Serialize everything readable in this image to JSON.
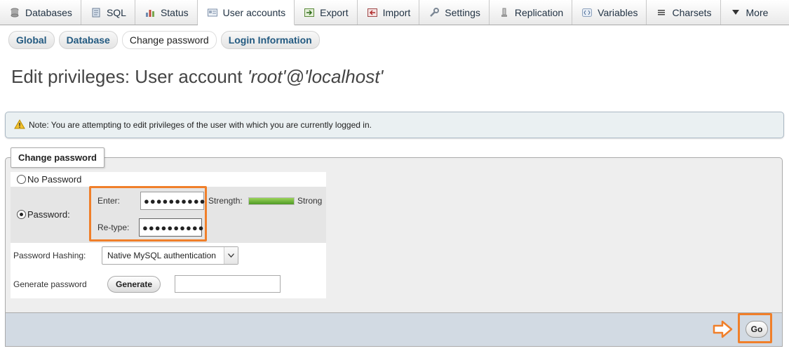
{
  "nav": {
    "tabs": [
      {
        "label": "Databases",
        "icon": "database-icon"
      },
      {
        "label": "SQL",
        "icon": "sql-icon"
      },
      {
        "label": "Status",
        "icon": "status-icon"
      },
      {
        "label": "User accounts",
        "icon": "user-accounts-icon",
        "active": true
      },
      {
        "label": "Export",
        "icon": "export-icon"
      },
      {
        "label": "Import",
        "icon": "import-icon"
      },
      {
        "label": "Settings",
        "icon": "wrench-icon"
      },
      {
        "label": "Replication",
        "icon": "replication-icon"
      },
      {
        "label": "Variables",
        "icon": "variables-icon"
      },
      {
        "label": "Charsets",
        "icon": "charsets-icon"
      },
      {
        "label": "More",
        "icon": "triangle-down-icon"
      }
    ]
  },
  "subnav": {
    "items": [
      {
        "label": "Global"
      },
      {
        "label": "Database"
      },
      {
        "label": "Change password",
        "active": true
      },
      {
        "label": "Login Information"
      }
    ]
  },
  "page": {
    "title_prefix": "Edit privileges: User account ",
    "title_user": "'root'@'localhost'"
  },
  "note": {
    "text": "Note: You are attempting to edit privileges of the user with which you are currently logged in.",
    "icon": "warning-icon"
  },
  "change_password": {
    "legend": "Change password",
    "no_password_label": "No Password",
    "password_label": "Password:",
    "enter_label": "Enter:",
    "enter_value": "●●●●●●●●●●",
    "retype_label": "Re-type:",
    "retype_value": "●●●●●●●●●●",
    "strength_label": "Strength:",
    "strength_text": "Strong",
    "strength_level": 1.0,
    "hashing_label": "Password Hashing:",
    "hashing_selected": "Native MySQL authentication",
    "generate_label": "Generate password",
    "generate_button": "Generate",
    "generated_value": ""
  },
  "footer": {
    "go_label": "Go"
  },
  "colors": {
    "highlight": "#f07f2a",
    "link": "#235a81",
    "strength": "#6cb33a",
    "footer_bg": "#d2dae3"
  }
}
